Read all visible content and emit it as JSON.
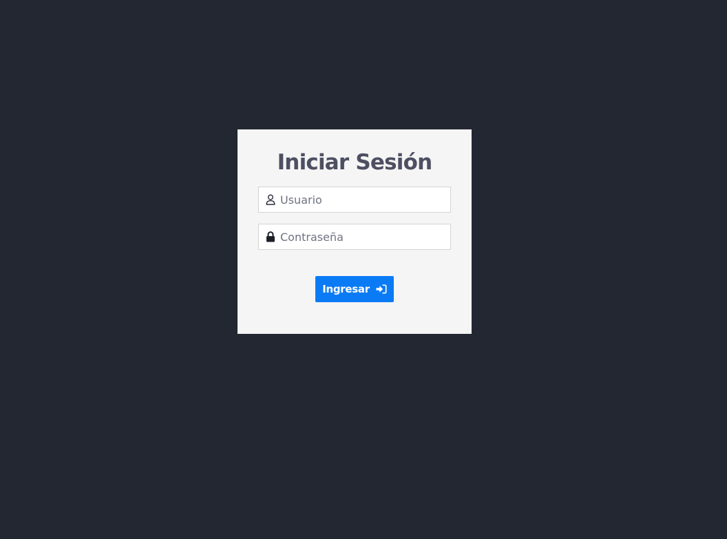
{
  "login": {
    "title": "Iniciar Sesión",
    "username_placeholder": "Usuario",
    "username_value": "",
    "password_placeholder": "Contraseña",
    "password_value": "",
    "submit_label": "Ingresar",
    "username_icon": "user-outline-icon",
    "password_icon": "lock-icon",
    "submit_icon": "sign-in-icon"
  },
  "colors": {
    "background": "#222731",
    "card": "#f5f5f5",
    "title": "#4d4f62",
    "button": "#0b7bf5"
  }
}
